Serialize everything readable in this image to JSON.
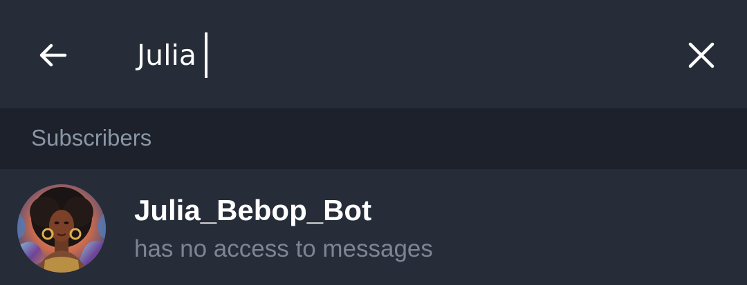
{
  "search": {
    "query": "Julia"
  },
  "section": {
    "title": "Subscribers"
  },
  "results": [
    {
      "name": "Julia_Bebop_Bot",
      "status": "has no access to messages"
    }
  ],
  "colors": {
    "background": "#252b36",
    "section_background": "#1c212b",
    "text_primary": "#ffffff",
    "text_secondary": "#7b8594",
    "section_text": "#8a96a6"
  },
  "icons": {
    "back": "arrow-left-icon",
    "clear": "close-icon"
  }
}
